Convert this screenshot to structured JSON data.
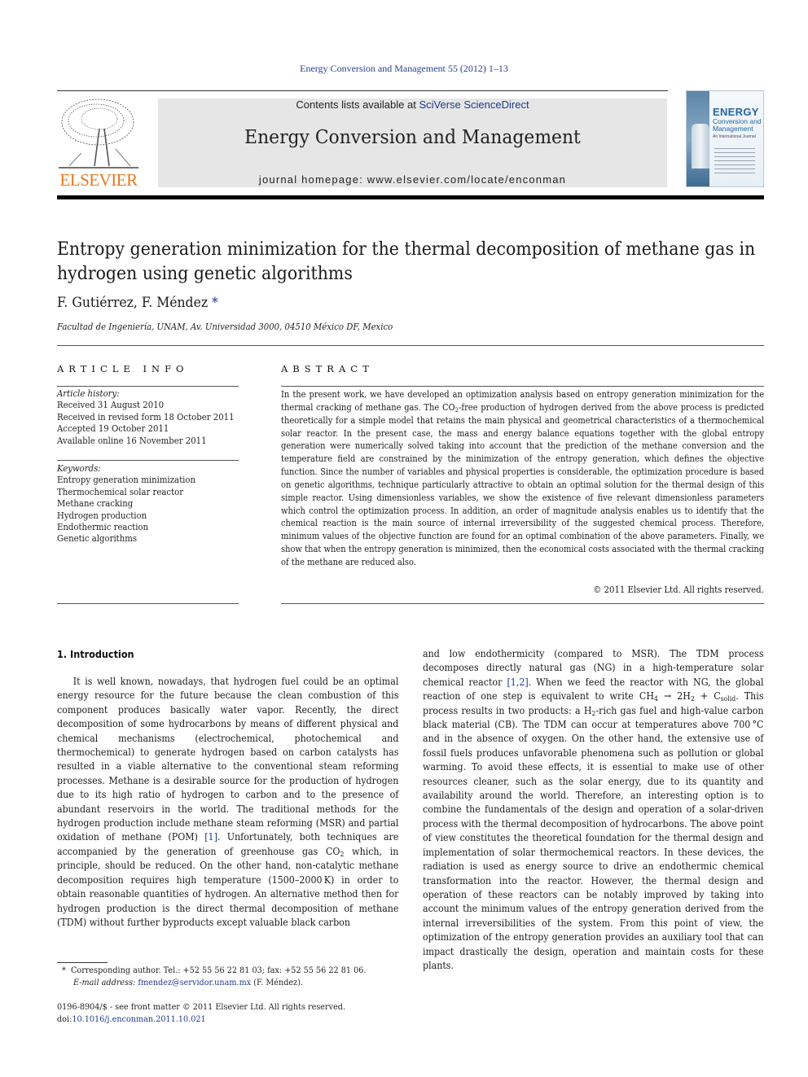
{
  "running_head": "Energy Conversion and Management 55 (2012) 1–13",
  "masthead": {
    "publisher_logo_text": "ELSEVIER",
    "contents_prefix": "Contents lists available at ",
    "contents_link": "SciVerse ScienceDirect",
    "journal_name": "Energy Conversion and Management",
    "homepage": "journal homepage: www.elsevier.com/locate/enconman",
    "cover": {
      "title_line1": "ENERGY",
      "title_line2": "Conversion and Management",
      "subtitle": "An International Journal"
    },
    "colors": {
      "elsevier_orange": "#e87722",
      "link_blue": "#1f3a8c",
      "masthead_gray": "#e6e6e6",
      "cover_blue": "#2565a3"
    }
  },
  "article": {
    "title": "Entropy generation minimization for the thermal decomposition of methane gas in hydrogen using genetic algorithms",
    "authors": "F. Gutiérrez, F. Méndez",
    "author_marker": "*",
    "affiliation": "Facultad de Ingeniería, UNAM, Av. Universidad 3000, 04510 México DF, Mexico"
  },
  "article_info": {
    "heading": "ARTICLE INFO",
    "history_label": "Article history:",
    "history": [
      "Received 31 August 2010",
      "Received in revised form 18 October 2011",
      "Accepted 19 October 2011",
      "Available online 16 November 2011"
    ],
    "keywords_label": "Keywords:",
    "keywords": [
      "Entropy generation minimization",
      "Thermochemical solar reactor",
      "Methane cracking",
      "Hydrogen production",
      "Endothermic reaction",
      "Genetic algorithms"
    ]
  },
  "abstract": {
    "heading": "ABSTRACT",
    "text_a": "In the present work, we have developed an optimization analysis based on entropy generation minimization for the thermal cracking of methane gas. The CO",
    "text_a_sub": "2",
    "text_b": "-free production of hydrogen derived from the above process is predicted theoretically for a simple model that retains the main physical and geometrical characteristics of a thermochemical solar reactor. In the present case, the mass and energy balance equations together with the global entropy generation were numerically solved taking into account that the prediction of the methane conversion and the temperature field are constrained by the minimization of the entropy generation, which defines the objective function. Since the number of variables and physical properties is considerable, the optimization procedure is based on genetic algorithms, technique particularly attractive to obtain an optimal solution for the thermal design of this simple reactor. Using dimensionless variables, we show the existence of five relevant dimensionless parameters which control the optimization process. In addition, an order of magnitude analysis enables us to identify that the chemical reaction is the main source of internal irreversibility of the suggested chemical process. Therefore, minimum values of the objective function are found for an optimal combination of the above parameters. Finally, we show that when the entropy generation is minimized, then the economical costs associated with the thermal cracking of the methane are reduced also.",
    "copyright": "© 2011 Elsevier Ltd. All rights reserved."
  },
  "introduction": {
    "heading": "1. Introduction",
    "left_p1": "It is well known, nowadays, that hydrogen fuel could be an optimal energy resource for the future because the clean combustion of this component produces basically water vapor. Recently, the direct decomposition of some hydrocarbons by means of different physical and chemical mechanisms (electrochemical, photochemical and thermochemical) to generate hydrogen based on carbon catalysts has resulted in a viable alternative to the conventional steam reforming processes. Methane is a desirable source for the production of hydrogen due to its high ratio of hydrogen to carbon and to the presence of abundant reservoirs in the world. The traditional methods for the hydrogen production include methane steam reforming (MSR) and partial oxidation of methane (POM) ",
    "left_ref1": "[1]",
    "left_p2": ". Unfortunately, both techniques are accompanied by the generation of greenhouse gas CO",
    "left_p2_sub": "2",
    "left_p3": " which, in principle, should be reduced. On the other hand, non-catalytic methane decomposition requires high temperature (1500–2000 K) in order to obtain reasonable quantities of hydrogen. An alternative method then for hydrogen production is the direct thermal decomposition of methane (TDM) without further byproducts except valuable black carbon",
    "right_p1": "and low endothermicity (compared to MSR). The TDM process decomposes directly natural gas (NG) in a high-temperature solar chemical reactor ",
    "right_ref": "[1,2]",
    "right_p2": ". When we feed the reactor with NG, the global reaction of one step is equivalent to write CH",
    "right_sub_4": "4",
    "right_arrow": " → 2H",
    "right_sub_2": "2",
    "right_plus": " + C",
    "right_sub_solid": "solid",
    "right_p3": ". This process results in two products: a H",
    "right_sub_h2": "2",
    "right_p4": "-rich gas fuel and high-value carbon black material (CB). The TDM can occur at temperatures above 700 °C and in the absence of oxygen. On the other hand, the extensive use of fossil fuels produces unfavorable phenomena such as pollution or global warming. To avoid these effects, it is essential to make use of other resources cleaner, such as the solar energy, due to its quantity and availability around the world. Therefore, an interesting option is to combine the fundamentals of the design and operation of a solar-driven process with the thermal decomposition of hydrocarbons. The above point of view constitutes the theoretical foundation for the thermal design and implementation of solar thermochemical reactors. In these devices, the radiation is used as energy source to drive an endothermic chemical transformation into the reactor. However, the thermal design and operation of these reactors can be notably improved by taking into account the minimum values of the entropy generation derived from the internal irreversibilities of the system. From this point of view, the optimization of the entropy generation provides an auxiliary tool that can impact drastically the design, operation and maintain costs for these plants."
  },
  "footnotes": {
    "corresponding_marker": "*",
    "corresponding": "Corresponding author. Tel.: +52 55 56 22 81 03; fax: +52 55 56 22 81 06.",
    "email_label": "E-mail address:",
    "email": "fmendez@servidor.unam.mx",
    "email_suffix": " (F. Méndez).",
    "front_matter": "0196-8904/$ - see front matter © 2011 Elsevier Ltd. All rights reserved.",
    "doi_prefix": "doi:",
    "doi": "10.1016/j.enconman.2011.10.021"
  }
}
